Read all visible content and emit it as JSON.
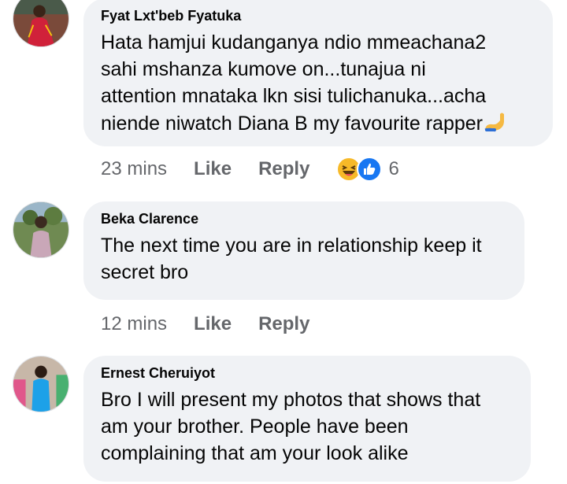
{
  "comments": [
    {
      "author": "Fyat Lxt'beb Fyatuka",
      "text": "Hata hamjui kudanganya ndio mmeachana2\nsahi mshanza kumove on...tunajua ni\nattention mnataka lkn sisi tulichanuka...acha\nniende niwatch Diana B my favourite rapper",
      "trailing_emoji": "flexed-biceps-icon",
      "time": "23 mins",
      "like_label": "Like",
      "reply_label": "Reply",
      "reaction_icons": [
        "haha-icon",
        "like-reaction-icon"
      ],
      "reaction_count": "6"
    },
    {
      "author": "Beka Clarence",
      "text": "The next time you are in relationship keep it\nsecret bro",
      "time": "12 mins",
      "like_label": "Like",
      "reply_label": "Reply"
    },
    {
      "author": "Ernest Cheruiyot",
      "text": "Bro I will present my photos that shows that\nam your brother. People have been\ncomplaining that am your look alike"
    }
  ],
  "colors": {
    "bubble": "#f0f2f5",
    "name": "#050505",
    "meta": "#65676b",
    "like_blue": "#1877f2",
    "haha_yellow": "#f7b928"
  }
}
